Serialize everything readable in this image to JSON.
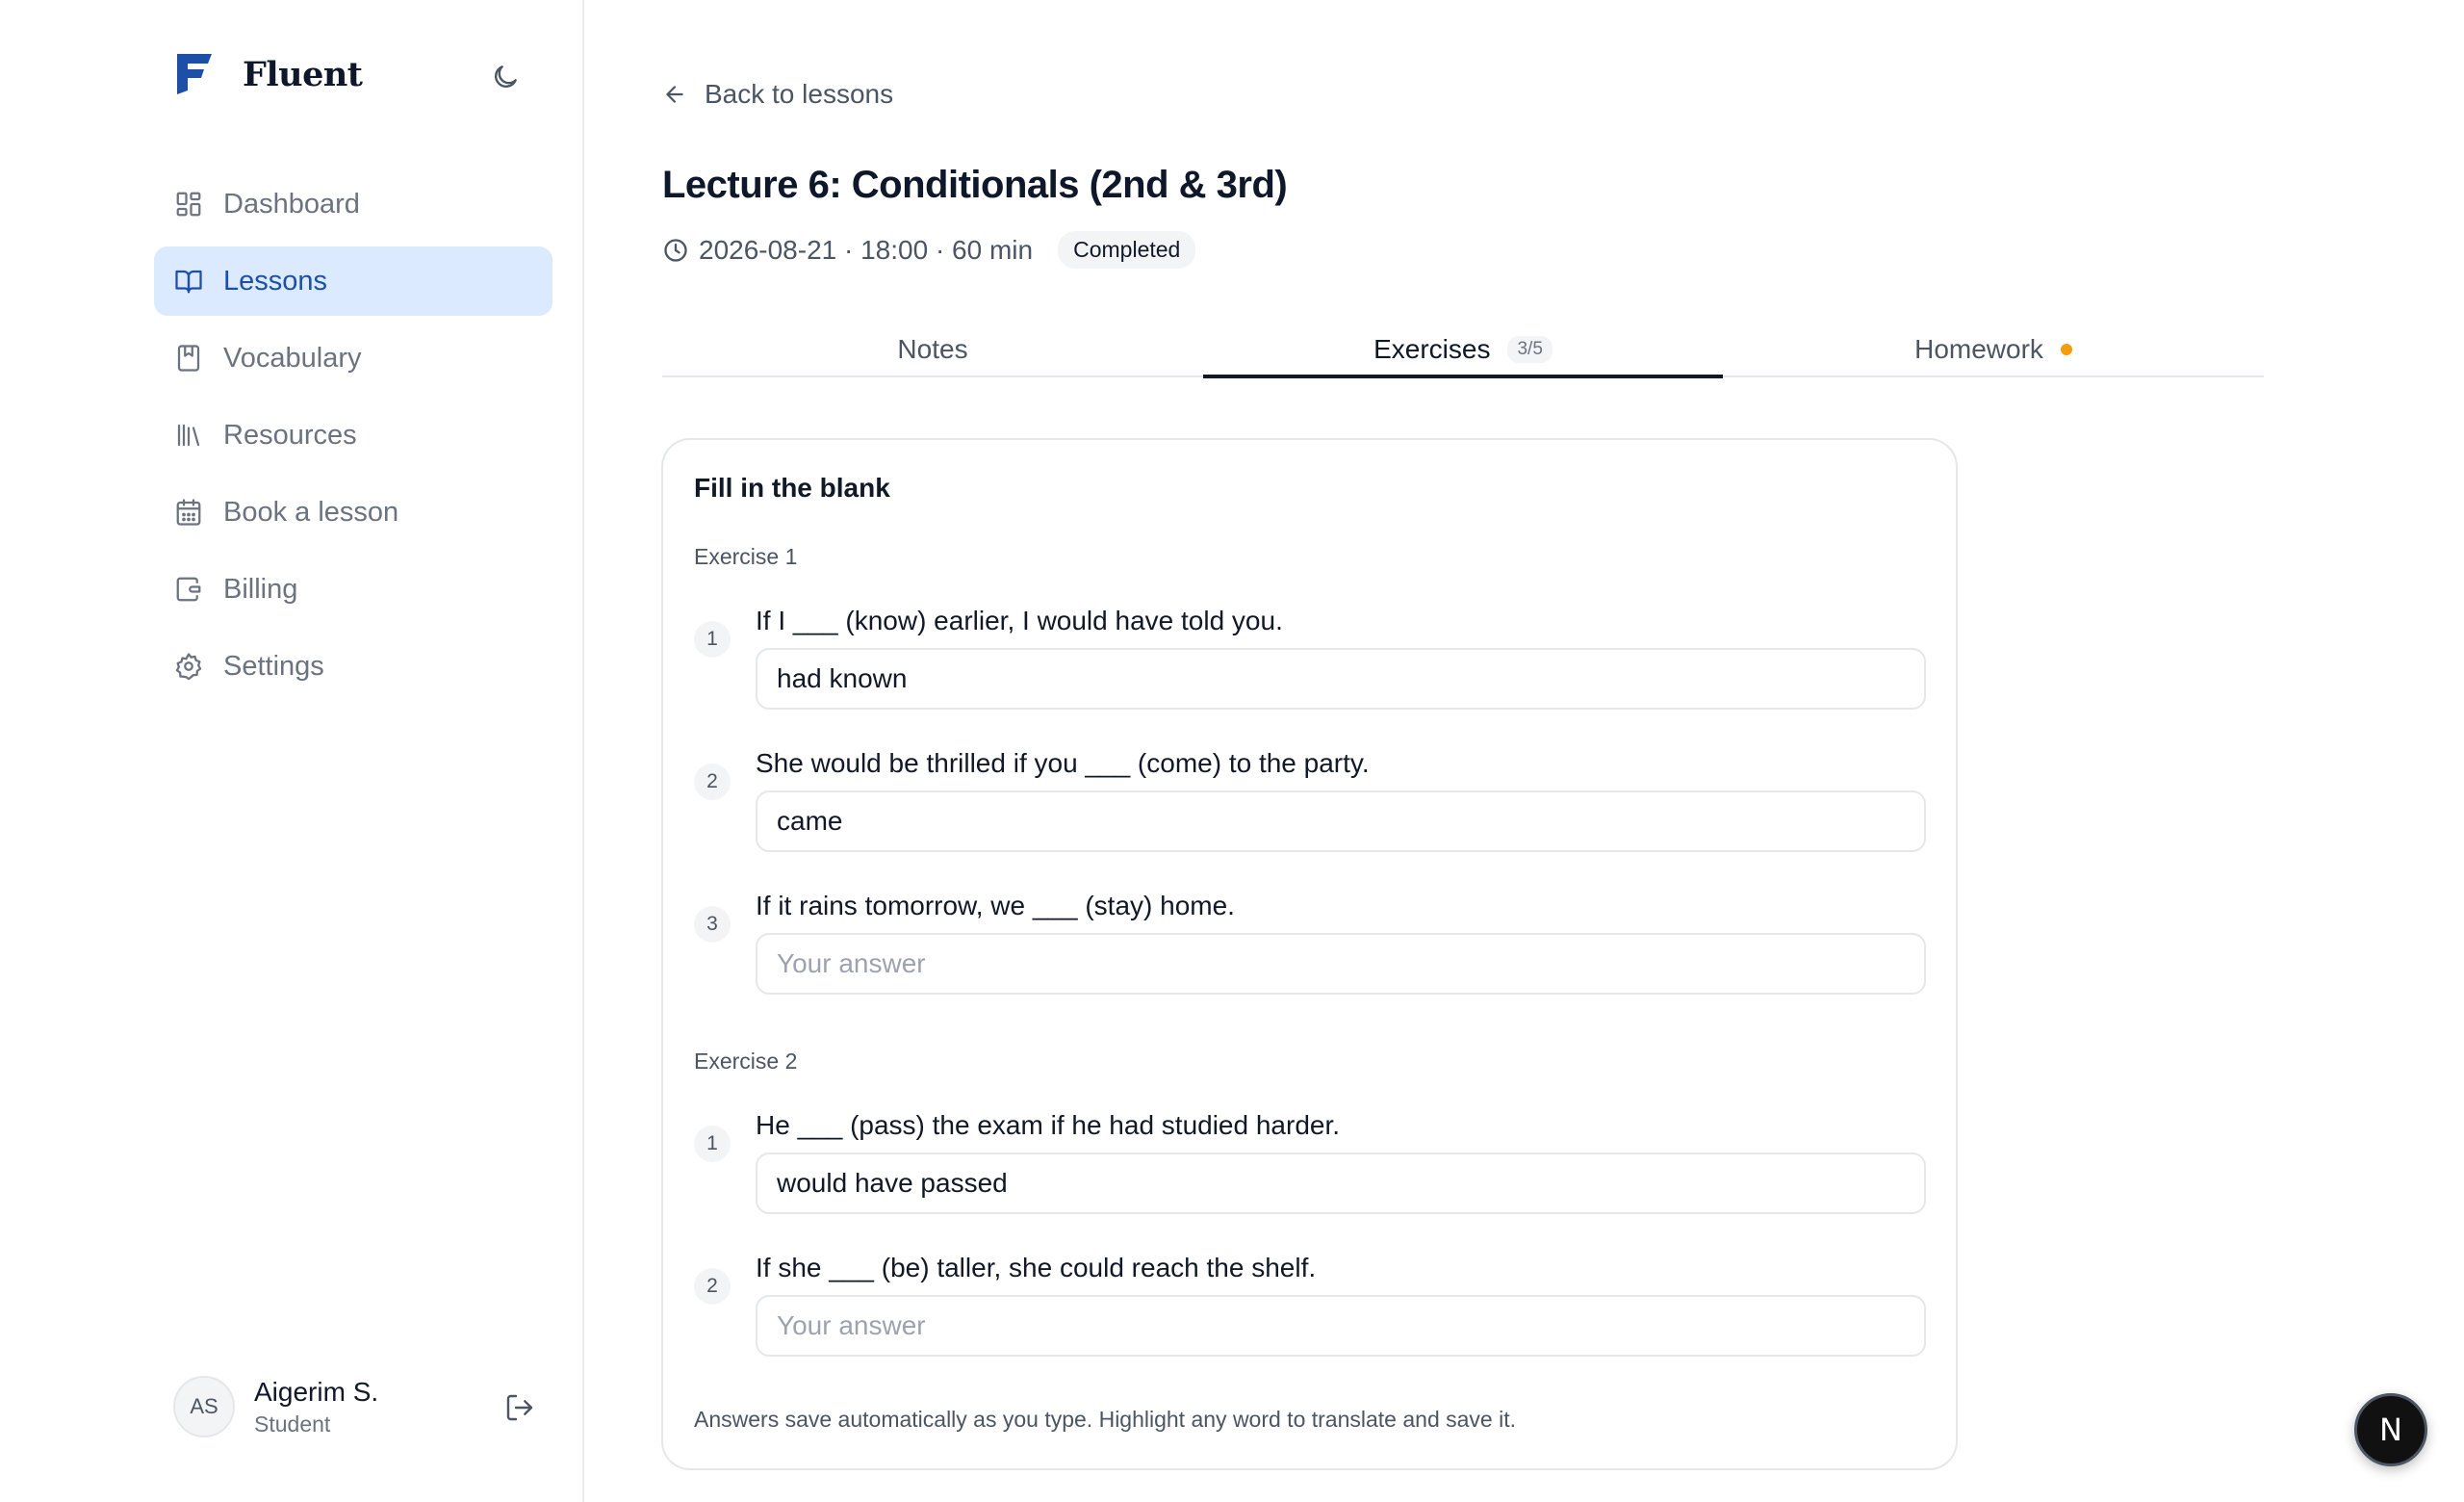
{
  "brand": {
    "name": "Fluent"
  },
  "sidebar": {
    "items": [
      {
        "label": "Dashboard",
        "icon": "dashboard-icon"
      },
      {
        "label": "Lessons",
        "icon": "book-open-icon",
        "active": true
      },
      {
        "label": "Vocabulary",
        "icon": "bookmark-book-icon"
      },
      {
        "label": "Resources",
        "icon": "library-icon"
      },
      {
        "label": "Book a lesson",
        "icon": "calendar-icon"
      },
      {
        "label": "Billing",
        "icon": "wallet-icon"
      },
      {
        "label": "Settings",
        "icon": "gear-icon"
      }
    ]
  },
  "user": {
    "initials": "AS",
    "name": "Aigerim S.",
    "role": "Student"
  },
  "main": {
    "back_label": "Back to lessons",
    "title": "Lecture 6: Conditionals (2nd & 3rd)",
    "meta": "2026-08-21 · 18:00 · 60 min",
    "status": "Completed",
    "tabs": [
      {
        "label": "Notes"
      },
      {
        "label": "Exercises",
        "count": "3/5",
        "active": true
      },
      {
        "label": "Homework",
        "indicator_color": "#f59e0b"
      }
    ]
  },
  "card": {
    "title": "Fill in the blank",
    "exercises": [
      {
        "label": "Exercise 1",
        "questions": [
          {
            "num": "1",
            "text": "If I ___ (know) earlier, I would have told you.",
            "value": "had known",
            "placeholder": "Your answer"
          },
          {
            "num": "2",
            "text": "She would be thrilled if you ___ (come) to the party.",
            "value": "came",
            "placeholder": "Your answer"
          },
          {
            "num": "3",
            "text": "If it rains tomorrow, we ___ (stay) home.",
            "value": "",
            "placeholder": "Your answer"
          }
        ]
      },
      {
        "label": "Exercise 2",
        "questions": [
          {
            "num": "1",
            "text": "He ___ (pass) the exam if he had studied harder.",
            "value": "would have passed",
            "placeholder": "Your answer"
          },
          {
            "num": "2",
            "text": "If she ___ (be) taller, she could reach the shelf.",
            "value": "",
            "placeholder": "Your answer"
          }
        ]
      }
    ],
    "footnote": "Answers save automatically as you type. Highlight any word to translate and save it."
  },
  "fab": {
    "label": "N"
  },
  "colors": {
    "accent": "#1e4fa8",
    "active_bg": "#dbeafe",
    "homework_dot": "#f59e0b"
  }
}
